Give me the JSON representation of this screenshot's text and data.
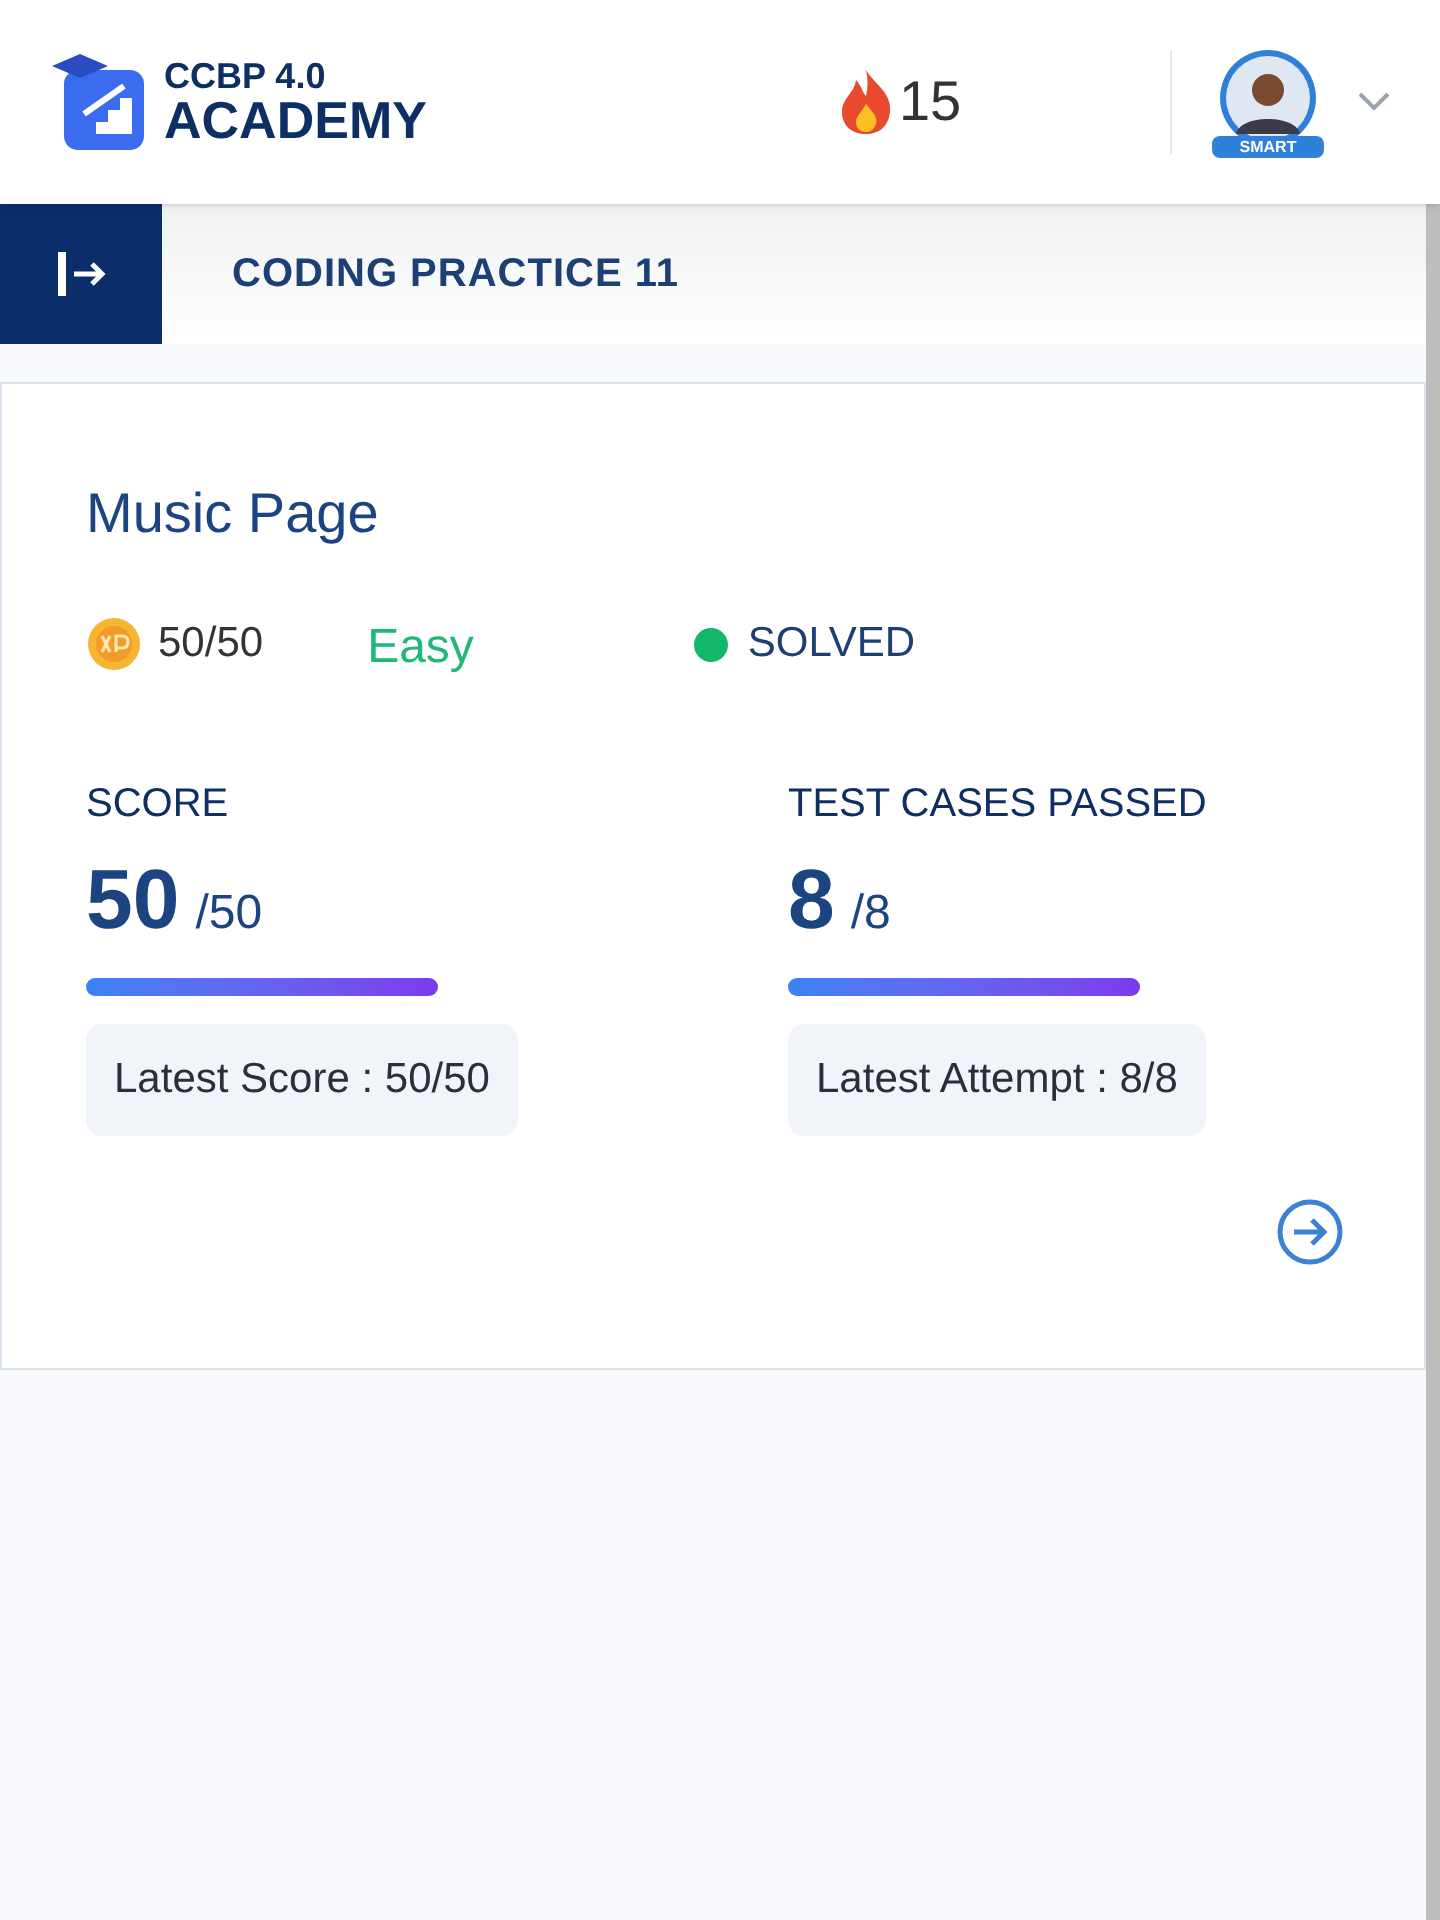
{
  "header": {
    "logo_top": "CCBP 4.0",
    "logo_bottom": "ACADEMY",
    "streak": "15",
    "avatar_badge": "SMART"
  },
  "subheader": {
    "title": "CODING PRACTICE 11"
  },
  "card": {
    "title": "Music Page",
    "xp": "50/50",
    "difficulty": "Easy",
    "status": "SOLVED",
    "stats": [
      {
        "label": "SCORE",
        "value": "50",
        "total": "/50",
        "level": 1,
        "latest": "Latest Score : 50/50"
      },
      {
        "label": "TEST CASES PASSED",
        "value": "8",
        "total": "/8",
        "level": 1,
        "latest": "Latest Attempt : 8/8"
      }
    ]
  }
}
